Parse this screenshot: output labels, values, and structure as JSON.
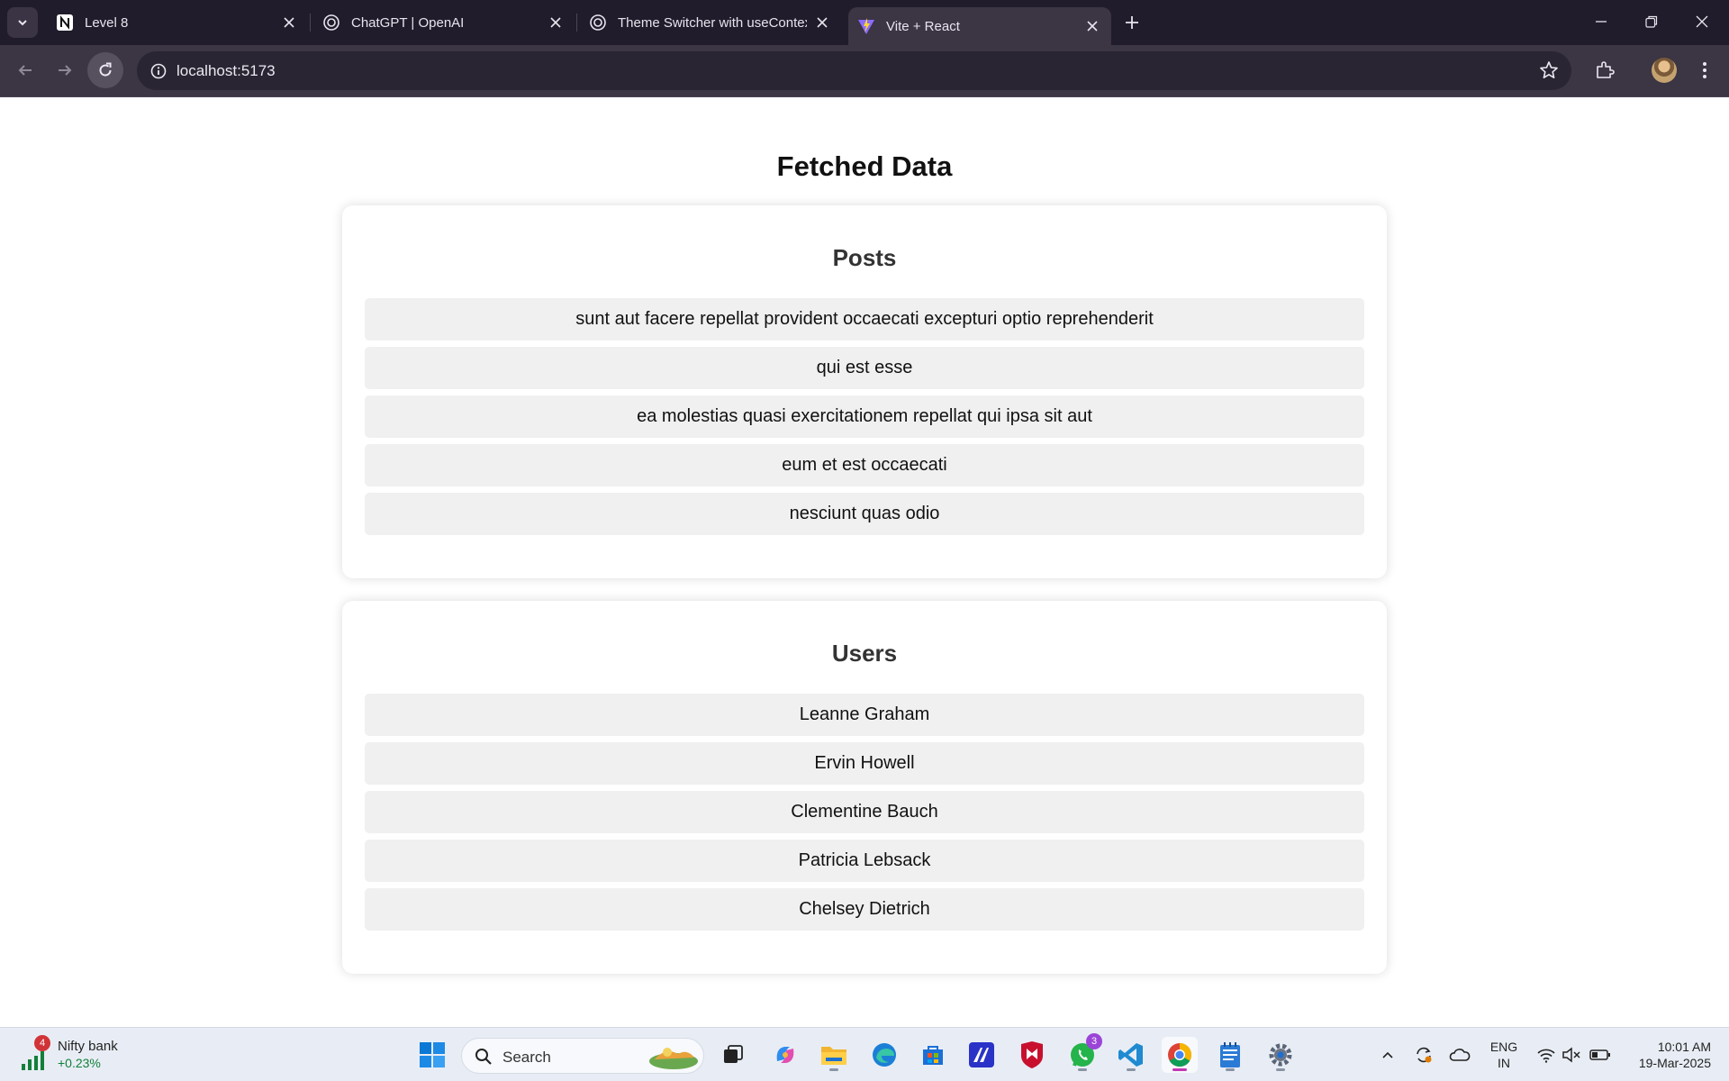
{
  "browser": {
    "tabs": [
      {
        "title": "Level 8",
        "icon": "notion-icon"
      },
      {
        "title": "ChatGPT | OpenAI",
        "icon": "openai-icon"
      },
      {
        "title": "Theme Switcher with useContext",
        "icon": "openai-icon"
      },
      {
        "title": "Vite + React",
        "icon": "vite-icon",
        "active": true
      }
    ],
    "url": "localhost:5173"
  },
  "page": {
    "title": "Fetched Data",
    "sections": [
      {
        "heading": "Posts",
        "items": [
          "sunt aut facere repellat provident occaecati excepturi optio reprehenderit",
          "qui est esse",
          "ea molestias quasi exercitationem repellat qui ipsa sit aut",
          "eum et est occaecati",
          "nesciunt quas odio"
        ]
      },
      {
        "heading": "Users",
        "items": [
          "Leanne Graham",
          "Ervin Howell",
          "Clementine Bauch",
          "Patricia Lebsack",
          "Chelsey Dietrich"
        ]
      }
    ]
  },
  "taskbar": {
    "widget": {
      "badge": "4",
      "name": "Nifty bank",
      "change": "+0.23%"
    },
    "search_label": "Search",
    "whatsapp_badge": "3",
    "language": {
      "line1": "ENG",
      "line2": "IN"
    },
    "clock": {
      "time": "10:01 AM",
      "date": "19-Mar-2025"
    }
  },
  "colors": {
    "tabstrip": "#211c2b",
    "toolbar": "#3b3544",
    "card_item_bg": "#f0f0f0",
    "taskbar": "#e8edf5"
  }
}
